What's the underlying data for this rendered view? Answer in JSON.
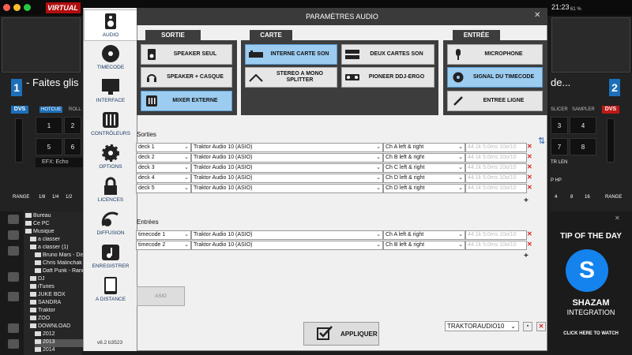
{
  "app": {
    "brand": "VIRTUAL",
    "clock": "21:23",
    "battery": "61 %",
    "deck_left_number": "1",
    "deck_right_number": "2",
    "deck_left_text": "- Faites glis",
    "deck_right_text": "de...",
    "dvs_label": "DVS",
    "hotcue_label": "HOTCUE",
    "roll_label": "ROLL",
    "slicer_label": "SLICER",
    "sampler_label": "SAMPLER",
    "pads_left": [
      "1",
      "2",
      "5",
      "6"
    ],
    "pads_right": [
      "3",
      "4",
      "7",
      "8"
    ],
    "efx_label": "EFX: Echo",
    "range_label": "RANGE",
    "loop_left": [
      "1/8",
      "1/4",
      "1/2"
    ],
    "loop_right": [
      "4",
      "8",
      "16"
    ],
    "right_strip_a": "TR  LEN",
    "right_strip_b": "P   HP"
  },
  "browser": {
    "items": [
      "Bureau",
      "Ce PC",
      "Musique",
      "a classer",
      "a classer (1)",
      "Bruno Mars - Disc",
      "Chris Malinchak",
      "Daft Punk - Rando",
      "DJ",
      "iTunes",
      "JUKE BOX",
      "SANDRA",
      "Traktor",
      "ZOO",
      "DOWNLOAD",
      "2012",
      "2013",
      "2014"
    ]
  },
  "tip": {
    "title": "TIP OF THE DAY",
    "brand": "SHAZAM",
    "integration": "INTEGRATION",
    "cta": "CLICK HERE TO WATCH"
  },
  "sidebar": {
    "items": [
      {
        "label": "AUDIO",
        "icon": "speaker-icon"
      },
      {
        "label": "TIMECODE",
        "icon": "vinyl-icon"
      },
      {
        "label": "INTERFACE",
        "icon": "monitor-icon"
      },
      {
        "label": "CONTRÔLEURS",
        "icon": "sliders-icon"
      },
      {
        "label": "OPTIONS",
        "icon": "gear-icon"
      },
      {
        "label": "LICENCES",
        "icon": "lock-icon"
      },
      {
        "label": "DIFFUSION",
        "icon": "broadcast-icon"
      },
      {
        "label": "ENREGISTRER",
        "icon": "music-note-icon"
      },
      {
        "label": "A DISTANCE",
        "icon": "tablet-icon"
      }
    ],
    "version": "v8.2 b3523"
  },
  "dialog": {
    "title": "PARAMÈTRES AUDIO",
    "groups": {
      "sortie": "SORTIE",
      "carte": "CARTE",
      "entree": "ENTRÉE"
    },
    "sortie_buttons": [
      "SPEAKER SEUL",
      "SPEAKER + CASQUE",
      "MIXER EXTERNE"
    ],
    "carte_buttons": [
      "INTERNE CARTE SON",
      "DEUX CARTES SON",
      "STEREO A MONO SPLITTER",
      "PIONEER DDJ-ERGO"
    ],
    "entree_buttons": [
      "MICROPHONE",
      "SIGNAL DU TIMECODE",
      "ENTREE LIGNE"
    ],
    "selected": [
      "MIXER EXTERNE",
      "INTERNE CARTE SON",
      "SIGNAL DU TIMECODE"
    ],
    "outputs_label": "Sorties",
    "outputs": [
      {
        "name": "deck 1",
        "device": "Traktor Audio 10 (ASIO)",
        "channel": "Ch A left & right",
        "info": "44.1k 5.0ms 10o/10"
      },
      {
        "name": "deck 2",
        "device": "Traktor Audio 10 (ASIO)",
        "channel": "Ch B left & right",
        "info": "44.1k 5.0ms 10o/10"
      },
      {
        "name": "deck 3",
        "device": "Traktor Audio 10 (ASIO)",
        "channel": "Ch C left & right",
        "info": "44.1k 5.0ms 10o/10"
      },
      {
        "name": "deck 4",
        "device": "Traktor Audio 10 (ASIO)",
        "channel": "Ch D left & right",
        "info": "44.1k 5.0ms 10o/10"
      },
      {
        "name": "deck 5",
        "device": "Traktor Audio 10 (ASIO)",
        "channel": "Ch D left & right",
        "info": "44.1k 5.0ms 10o/10"
      }
    ],
    "inputs_label": "Entrées",
    "inputs": [
      {
        "name": "timecode 1",
        "device": "Traktor Audio 10 (ASIO)",
        "channel": "Ch A left & right",
        "info": "44.1k 5.0ms 10o/10"
      },
      {
        "name": "timecode 2",
        "device": "Traktor Audio 10 (ASIO)",
        "channel": "Ch B left & right",
        "info": "44.1k 5.0ms 10o/10"
      }
    ],
    "asio_label": "ASIO",
    "apply_label": "APPLIQUER",
    "preset": "TRAKTORAUDIO10"
  },
  "colors": {
    "accent": "#1d6fb8",
    "selected": "#9cccf0",
    "dvs_left": "#1d6fb8",
    "dvs_right": "#c01818"
  }
}
